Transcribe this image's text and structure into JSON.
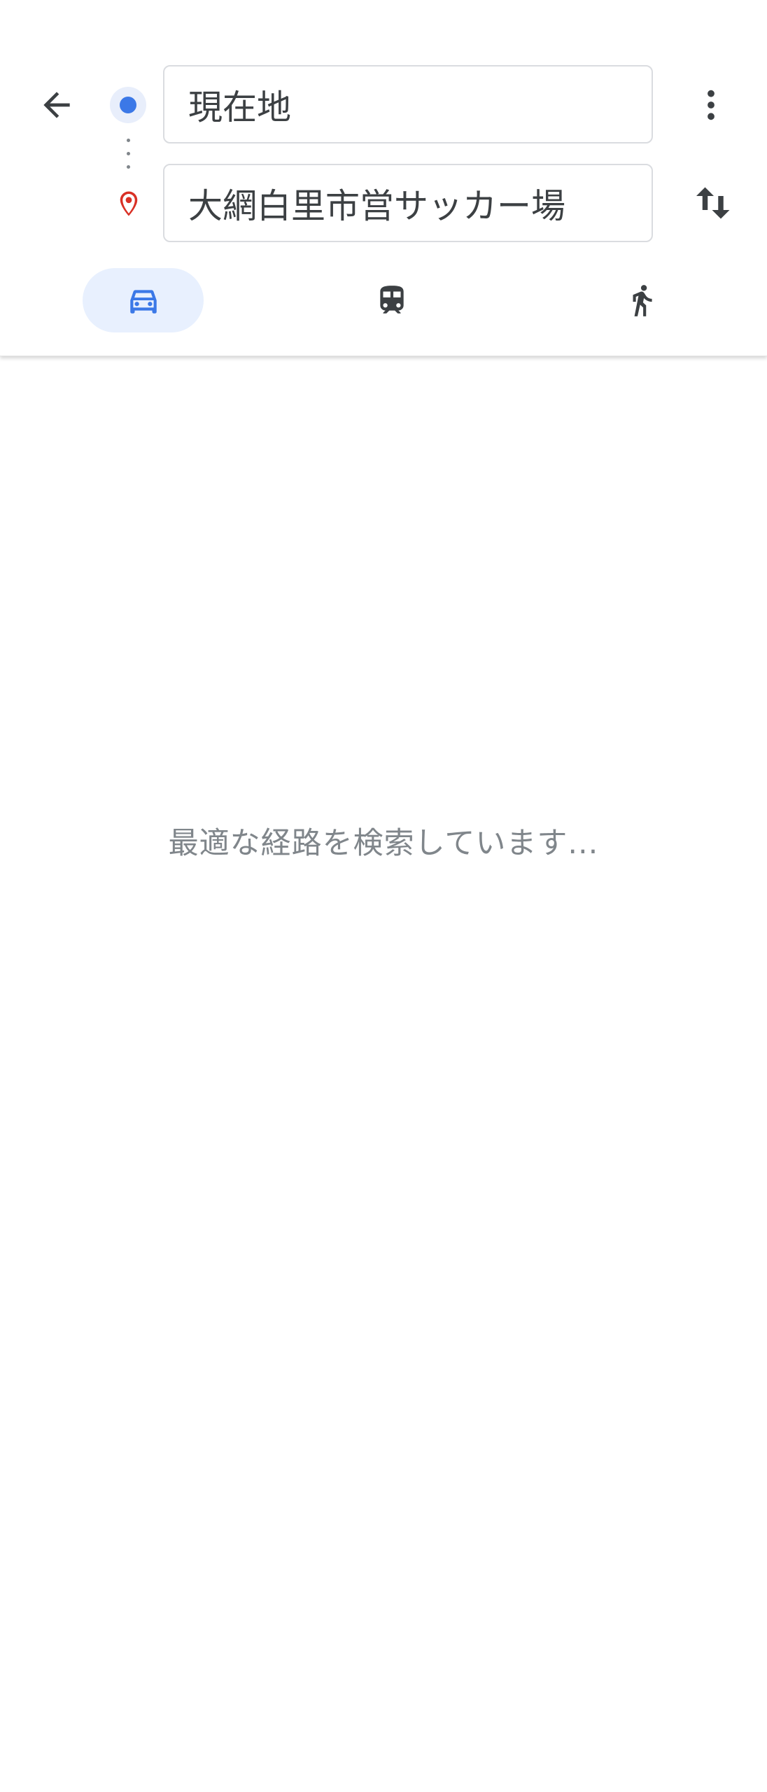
{
  "directions": {
    "origin_value": "現在地",
    "destination_value": "大網白里市営サッカー場"
  },
  "modes": [
    {
      "icon": "car-icon",
      "selected": true
    },
    {
      "icon": "train-icon",
      "selected": false
    },
    {
      "icon": "walk-icon",
      "selected": false
    }
  ],
  "status": {
    "loading_text": "最適な経路を検索しています..."
  },
  "colors": {
    "accent": "#3b78e7",
    "selected_tab_bg": "#e8f0fe",
    "pin_red": "#d93025",
    "icon_dark": "#3c4043",
    "muted_text": "#80868b"
  }
}
